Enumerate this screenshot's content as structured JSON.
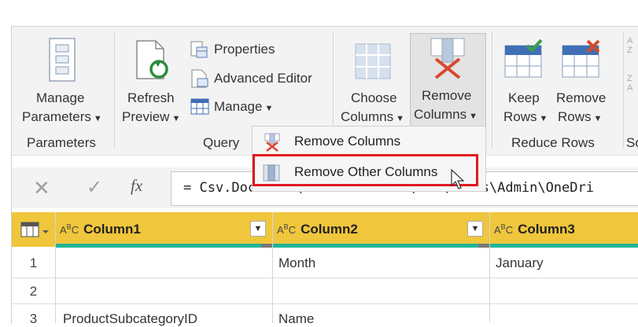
{
  "ribbon": {
    "manage_parameters": {
      "line1": "Manage",
      "line2": "Parameters"
    },
    "group_parameters": "Parameters",
    "refresh_preview": {
      "line1": "Refresh",
      "line2": "Preview"
    },
    "properties": "Properties",
    "advanced_editor": "Advanced Editor",
    "manage": "Manage",
    "group_query": "Query",
    "choose_columns": {
      "line1": "Choose",
      "line2": "Columns"
    },
    "remove_columns": {
      "line1": "Remove",
      "line2": "Columns"
    },
    "keep_rows": {
      "line1": "Keep",
      "line2": "Rows"
    },
    "remove_rows": {
      "line1": "Remove",
      "line2": "Rows"
    },
    "group_reduce_rows": "Reduce Rows",
    "group_partial": "Sc"
  },
  "dropdown": {
    "items": [
      "Remove Columns",
      "Remove Other Columns"
    ],
    "highlighted": "Remove Other Columns"
  },
  "formula": {
    "text": "= Csv.Document(File.Contents(\"C:\\Users\\Admin\\OneDri"
  },
  "grid": {
    "columns": [
      {
        "type_icon": "ABC",
        "name": "Column1"
      },
      {
        "type_icon": "ABC",
        "name": "Column2"
      },
      {
        "type_icon": "ABC",
        "name": "Column3"
      }
    ],
    "rows": [
      {
        "num": "1",
        "cells": [
          "",
          "Month",
          "January"
        ]
      },
      {
        "num": "2",
        "cells": [
          "",
          "",
          ""
        ]
      },
      {
        "num": "3",
        "cells": [
          "ProductSubcategoryID",
          "Name",
          ""
        ]
      }
    ]
  },
  "colors": {
    "accent_header": "#f0c63c",
    "quality_bar": "#1fb59a",
    "highlight_border": "#e0191f"
  }
}
